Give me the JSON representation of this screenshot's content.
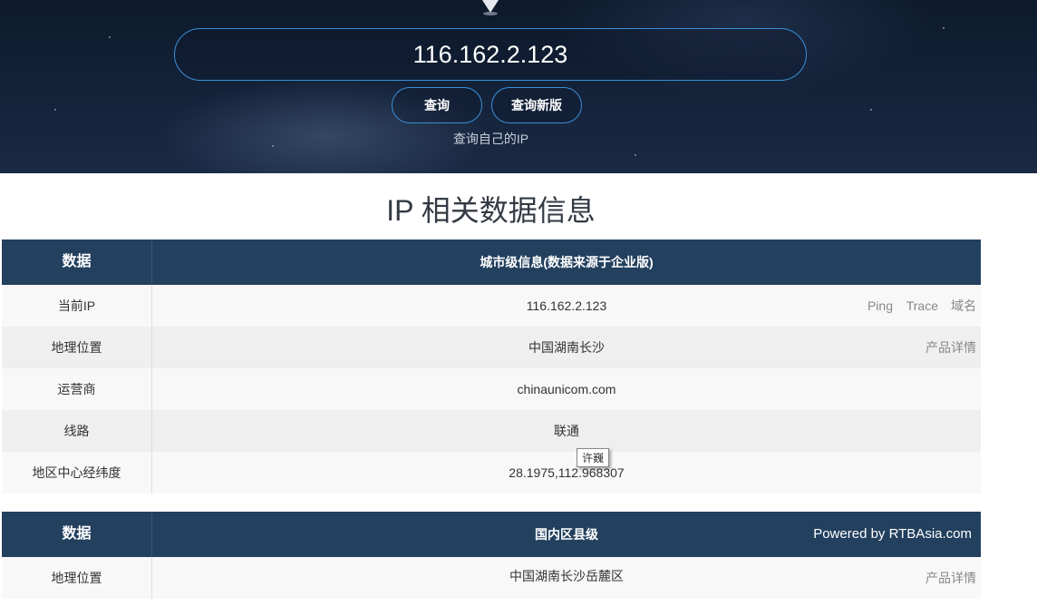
{
  "search": {
    "value": "116.162.2.123"
  },
  "buttons": {
    "query": "查询",
    "query_new": "查询新版"
  },
  "self_ip_link": "查询自己的IP",
  "page_title": "IP 相关数据信息",
  "table1": {
    "header": {
      "col1": "数据",
      "col2": "城市级信息(数据来源于企业版)"
    },
    "rows": [
      {
        "label": "当前IP",
        "value": "116.162.2.123",
        "actions": [
          "Ping",
          "Trace",
          "域名"
        ]
      },
      {
        "label": "地理位置",
        "value": "中国湖南长沙",
        "actions": [
          "产品详情"
        ]
      },
      {
        "label": "运营商",
        "value": "chinaunicom.com"
      },
      {
        "label": "线路",
        "value": "联通"
      },
      {
        "label": "地区中心经纬度",
        "value": "28.1975,112.968307"
      }
    ]
  },
  "tooltip": "许巍",
  "table2": {
    "header": {
      "col1": "数据",
      "col2": "国内区县级",
      "powered": "Powered by RTBAsia.com"
    },
    "rows": [
      {
        "label": "地理位置",
        "value": "中国湖南长沙岳麓区",
        "actions": [
          "产品详情"
        ]
      }
    ]
  }
}
